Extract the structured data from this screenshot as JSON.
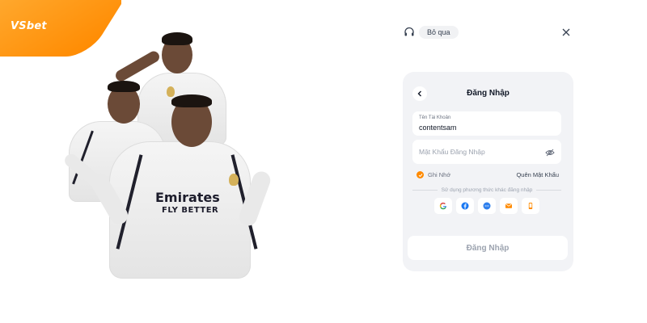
{
  "brand": {
    "logo": "VSbet",
    "accent": "#ff8a00"
  },
  "header": {
    "support_icon": "headset-icon",
    "skip_label": "Bỏ qua",
    "close_icon": "close-icon"
  },
  "login": {
    "title": "Đăng Nhập",
    "back_icon": "chevron-left-icon",
    "username": {
      "label": "Tên Tài Khoản",
      "value": "contentsam"
    },
    "password": {
      "placeholder": "Mật Khẩu Đăng Nhập",
      "icon": "eye-off-icon"
    },
    "remember_label": "Ghi Nhớ",
    "remember_checked": true,
    "forgot_label": "Quên Mật Khẩu",
    "alt_login_text": "Sử dụng phương thức khác đăng nhập",
    "social": [
      "google-icon",
      "facebook-icon",
      "chat-icon",
      "email-icon",
      "phone-icon"
    ],
    "submit_label": "Đăng Nhập"
  },
  "hero": {
    "sponsor_text_1": "Emirates",
    "sponsor_text_2": "FLY BETTER"
  }
}
